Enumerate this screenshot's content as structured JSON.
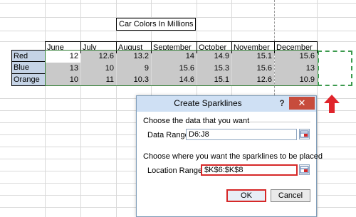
{
  "sheet": {
    "title": "Car Colors In Millions",
    "months": [
      "June",
      "July",
      "August",
      "September",
      "October",
      "November",
      "December"
    ],
    "rows": [
      {
        "label": "Red",
        "values": [
          "12",
          "12.6",
          "13.2",
          "14",
          "14.9",
          "15.1",
          "15.6"
        ]
      },
      {
        "label": "Blue",
        "values": [
          "13",
          "10",
          "9",
          "15.6",
          "15.3",
          "15.6",
          "13"
        ]
      },
      {
        "label": "Orange",
        "values": [
          "10",
          "11",
          "10.3",
          "14.6",
          "15.1",
          "12.6",
          "10.9"
        ]
      }
    ]
  },
  "dialog": {
    "title": "Create Sparklines",
    "help_label": "?",
    "close_label": "✕",
    "data_section_label": "Choose the data that you want",
    "data_range_label": "Data Range:",
    "data_range_value": "D6:J8",
    "location_section_label": "Choose where you want the sparklines to be placed",
    "location_range_label": "Location Range:",
    "location_range_value": "$K$6:$K$8",
    "ok_label": "OK",
    "cancel_label": "Cancel"
  },
  "colors": {
    "row_label_fill": "#c5d3e6",
    "data_fill": "#c9c9c9",
    "selection_outline": "#2e7d32",
    "highlight_red": "#d62828"
  }
}
